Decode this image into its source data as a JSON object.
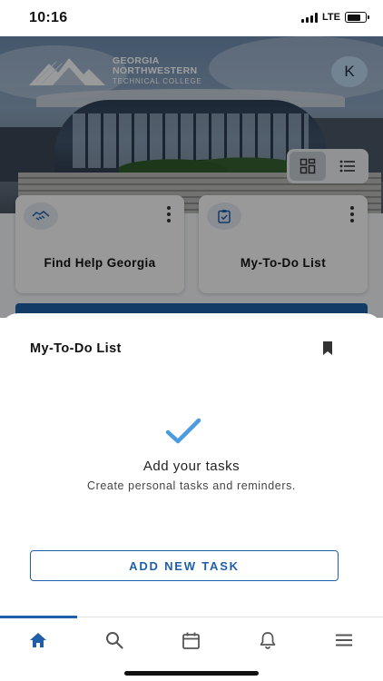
{
  "status_bar": {
    "time": "10:16",
    "network": "LTE",
    "battery_level": 0.75
  },
  "header": {
    "logo": {
      "line1": "GEORGIA",
      "line2": "NORTHWESTERN",
      "line3": "TECHNICAL COLLEGE"
    },
    "avatar_initial": "K",
    "view_toggle": {
      "selected": "grid",
      "options": [
        "grid-icon",
        "list-icon"
      ]
    }
  },
  "cards": [
    {
      "label": "Find Help Georgia",
      "icon": "handshake-icon"
    },
    {
      "label": "My-To-Do List",
      "icon": "clipboard-check-icon"
    }
  ],
  "sheet": {
    "title": "My-To-Do List",
    "bookmark_icon": "bookmark-icon",
    "empty_state": {
      "icon": "checkmark-icon",
      "title": "Add your tasks",
      "subtitle": "Create personal tasks and reminders."
    },
    "action_label": "ADD NEW TASK"
  },
  "tabbar": {
    "active": "home",
    "items": [
      "home-icon",
      "search-icon",
      "calendar-icon",
      "bell-icon",
      "menu-icon"
    ]
  },
  "colors": {
    "accent": "#1f5fa8",
    "check": "#4a9be0",
    "avatar_bg": "#b9d3ec"
  }
}
